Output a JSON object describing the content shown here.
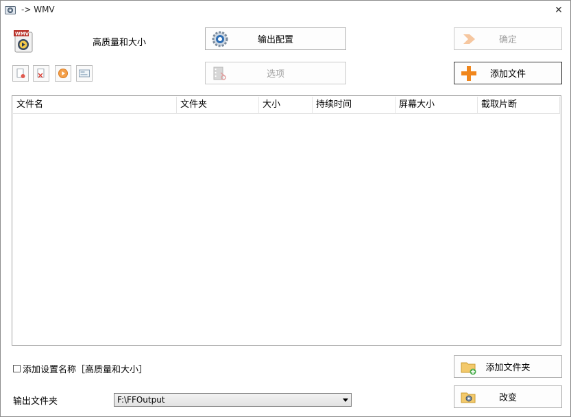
{
  "window": {
    "title": "-> WMV",
    "close_glyph": "✕"
  },
  "preset": {
    "logo_text": "WMV",
    "name": "高质量和大小"
  },
  "buttons": {
    "output_config": "输出配置",
    "options": "选项",
    "ok": "确定",
    "add_file": "添加文件",
    "add_folder": "添加文件夹",
    "change": "改变"
  },
  "toolbar": [
    {
      "icon": "remove-file-icon"
    },
    {
      "icon": "clear-list-icon"
    },
    {
      "icon": "play-icon"
    },
    {
      "icon": "media-info-icon"
    }
  ],
  "file_list": {
    "columns": [
      "文件名",
      "文件夹",
      "大小",
      "持续时间",
      "屏幕大小",
      "截取片断"
    ],
    "rows": []
  },
  "add_setting_name": {
    "label": "添加设置名称［高质量和大小］",
    "checked": false
  },
  "output_folder": {
    "label": "输出文件夹",
    "value": "F:\\FFOutput"
  },
  "colors": {
    "accent_orange": "#f0861c",
    "disabled_text": "#a0a0a0",
    "border": "#adadad"
  }
}
